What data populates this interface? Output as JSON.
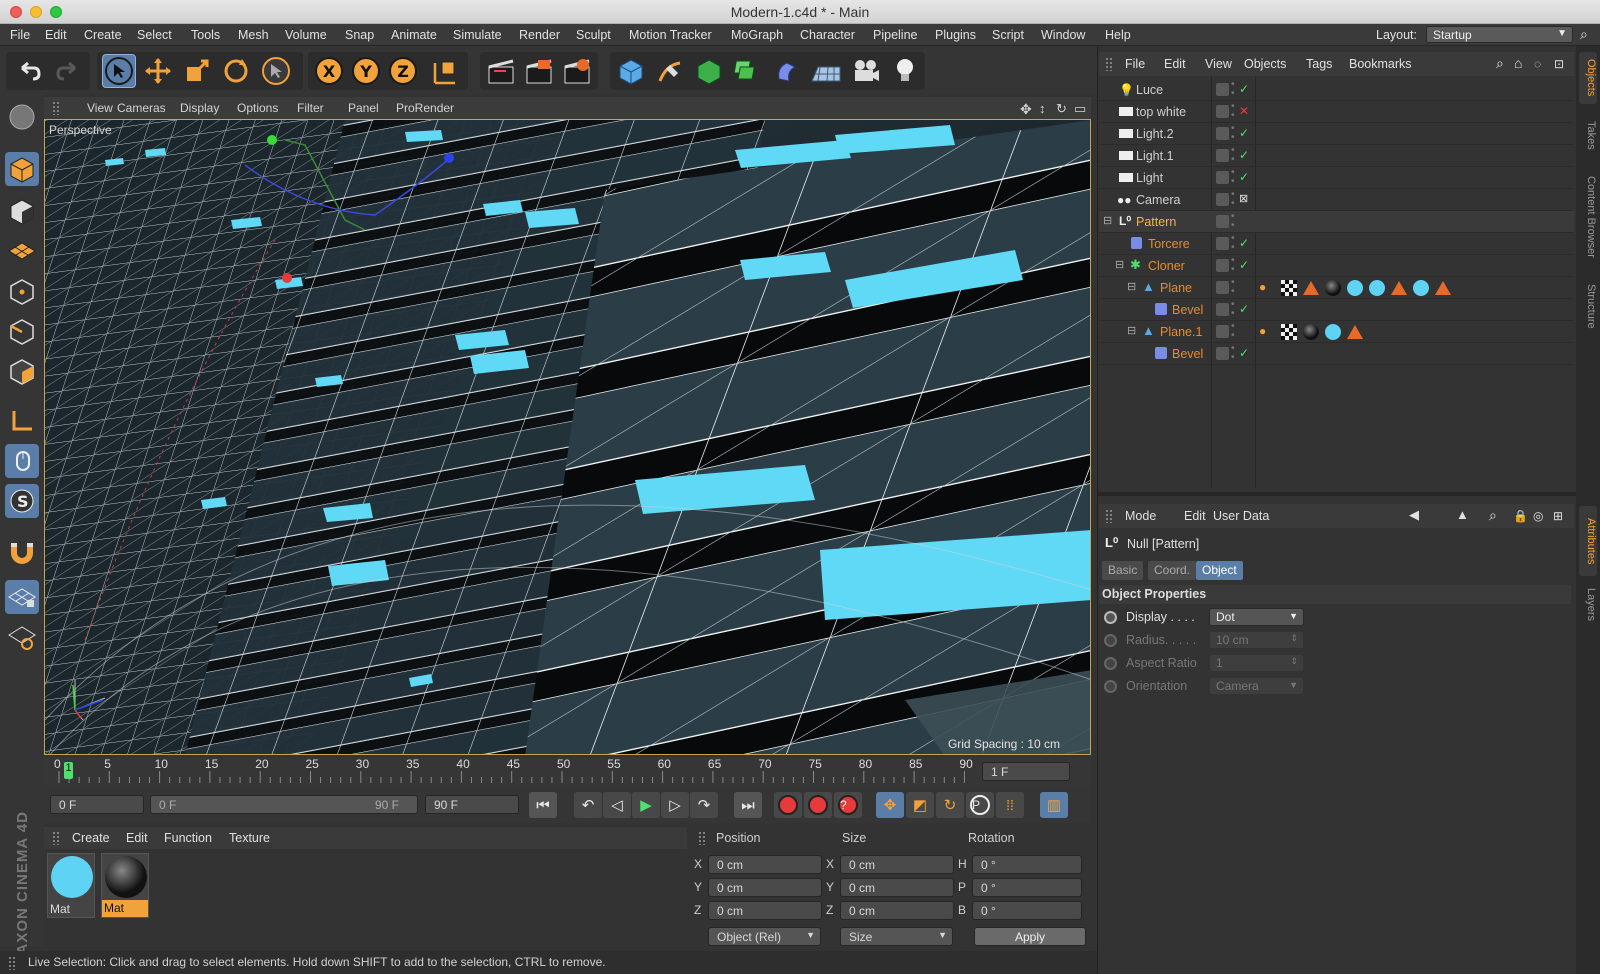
{
  "window": {
    "title": "Modern-1.c4d * - Main"
  },
  "menubar": {
    "items": [
      "File",
      "Edit",
      "Create",
      "Select",
      "Tools",
      "Mesh",
      "Volume",
      "Snap",
      "Animate",
      "Simulate",
      "Render",
      "Sculpt",
      "Motion Tracker",
      "MoGraph",
      "Character",
      "Pipeline",
      "Plugins",
      "Script",
      "Window",
      "Help"
    ],
    "layout_label": "Layout:",
    "layout_value": "Startup"
  },
  "toolbar": {
    "axis_x": "X",
    "axis_y": "Y",
    "axis_z": "Z"
  },
  "viewport": {
    "menu": [
      "View",
      "Cameras",
      "Display",
      "Options",
      "Filter",
      "Panel",
      "ProRender"
    ],
    "camera_label": "Perspective",
    "grid_spacing": "Grid Spacing : 10 cm"
  },
  "timeline": {
    "ticks": [
      "0",
      "5",
      "10",
      "15",
      "20",
      "25",
      "30",
      "35",
      "40",
      "45",
      "50",
      "55",
      "60",
      "65",
      "70",
      "75",
      "80",
      "85",
      "90"
    ],
    "current_marker": "1",
    "frame_field": "1 F"
  },
  "playbar": {
    "start_field": "0 F",
    "range_start": "0 F",
    "range_end": "90 F",
    "end_field": "90 F"
  },
  "materials": {
    "menu": [
      "Create",
      "Edit",
      "Function",
      "Texture"
    ],
    "items": [
      {
        "label": "Mat",
        "color": "#5fd3f3",
        "selected": false
      },
      {
        "label": "Mat",
        "color": "#1a1a1a",
        "selected": true
      }
    ]
  },
  "coordinates": {
    "headers": [
      "Position",
      "Size",
      "Rotation"
    ],
    "rows": [
      {
        "pos_axis": "X",
        "pos": "0 cm",
        "size_axis": "X",
        "size": "0 cm",
        "rot_axis": "H",
        "rot": "0 °"
      },
      {
        "pos_axis": "Y",
        "pos": "0 cm",
        "size_axis": "Y",
        "size": "0 cm",
        "rot_axis": "P",
        "rot": "0 °"
      },
      {
        "pos_axis": "Z",
        "pos": "0 cm",
        "size_axis": "Z",
        "size": "0 cm",
        "rot_axis": "B",
        "rot": "0 °"
      }
    ],
    "mode_dropdown": "Object (Rel)",
    "size_dropdown": "Size",
    "apply_label": "Apply"
  },
  "status": {
    "text": "Live Selection: Click and drag to select elements. Hold down SHIFT to add to the selection, CTRL to remove."
  },
  "brand": {
    "text": "MAXON CINEMA 4D"
  },
  "object_manager": {
    "menu": [
      "File",
      "Edit",
      "View",
      "Objects",
      "Tags",
      "Bookmarks"
    ],
    "objects": [
      {
        "name": "Luce",
        "color": "#e8e8e8",
        "status": "check"
      },
      {
        "name": "top white",
        "color": "#e8e8e8",
        "status": "cross"
      },
      {
        "name": "Light.2",
        "color": "#e8e8e8",
        "status": "check"
      },
      {
        "name": "Light.1",
        "color": "#e8e8e8",
        "status": "check"
      },
      {
        "name": "Light",
        "color": "#e8e8e8",
        "status": "check"
      },
      {
        "name": "Camera",
        "color": "#e8e8e8",
        "status": "target"
      },
      {
        "name": "Pattern",
        "color": "#f5b63c",
        "status": "none"
      },
      {
        "name": "Torcere",
        "color": "#e88b2a",
        "status": "check"
      },
      {
        "name": "Cloner",
        "color": "#e88b2a",
        "status": "check"
      },
      {
        "name": "Plane",
        "color": "#e88b2a",
        "status": "none"
      },
      {
        "name": "Bevel",
        "color": "#e88b2a",
        "status": "check"
      },
      {
        "name": "Plane.1",
        "color": "#e88b2a",
        "status": "none"
      },
      {
        "name": "Bevel",
        "color": "#e88b2a",
        "status": "check"
      }
    ]
  },
  "attributes": {
    "menu": [
      "Mode",
      "Edit",
      "User Data"
    ],
    "object_title": "Null [Pattern]",
    "tabs": [
      "Basic",
      "Coord.",
      "Object"
    ],
    "active_tab": "Object",
    "section": "Object Properties",
    "props": [
      {
        "label": "Display . . . .",
        "value": "Dot",
        "enabled": true
      },
      {
        "label": "Radius. . . . .",
        "value": "10 cm",
        "enabled": false
      },
      {
        "label": "Aspect Ratio",
        "value": "1",
        "enabled": false
      },
      {
        "label": "Orientation",
        "value": "Camera",
        "enabled": false
      }
    ]
  },
  "side_tabs": {
    "top": [
      "Objects",
      "Takes",
      "Content Browser",
      "Structure"
    ],
    "bottom": [
      "Attributes",
      "Layers"
    ]
  }
}
